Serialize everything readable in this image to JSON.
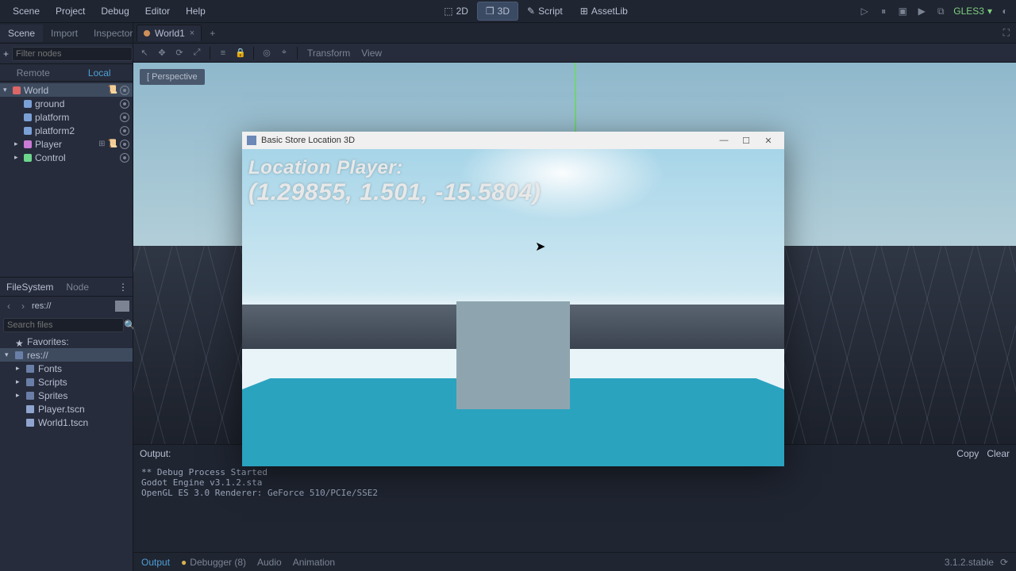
{
  "menu": {
    "items": [
      "Scene",
      "Project",
      "Debug",
      "Editor",
      "Help"
    ]
  },
  "center_modes": {
    "d2": "2D",
    "d3": "3D",
    "script": "Script",
    "assetlib": "AssetLib",
    "active": "d3"
  },
  "top_right": {
    "renderer": "GLES3"
  },
  "scene_panel": {
    "tabs": [
      "Scene",
      "Import",
      "Inspector"
    ],
    "active_tab": 0,
    "filter_placeholder": "Filter nodes",
    "remote": "Remote",
    "local": "Local",
    "nodes": [
      {
        "name": "World",
        "kind": "world",
        "depth": 0,
        "expanded": true,
        "selected": true,
        "script": true,
        "vis": true
      },
      {
        "name": "ground",
        "kind": "mesh",
        "depth": 1,
        "vis": true
      },
      {
        "name": "platform",
        "kind": "mesh",
        "depth": 1,
        "vis": true
      },
      {
        "name": "platform2",
        "kind": "mesh",
        "depth": 1,
        "vis": true
      },
      {
        "name": "Player",
        "kind": "player",
        "depth": 1,
        "expanded": false,
        "script": true,
        "link": true,
        "vis": true
      },
      {
        "name": "Control",
        "kind": "ctrl",
        "depth": 1,
        "expanded": false,
        "vis": true
      }
    ]
  },
  "filesystem": {
    "tabs": [
      "FileSystem",
      "Node"
    ],
    "active_tab": 0,
    "path": "res://",
    "search_placeholder": "Search files",
    "items": [
      {
        "label": "Favorites:",
        "icon": "star",
        "caret": ""
      },
      {
        "label": "res://",
        "icon": "folder",
        "caret": "▾",
        "selected": true
      },
      {
        "label": "Fonts",
        "icon": "folder",
        "caret": "▸",
        "indent": 1
      },
      {
        "label": "Scripts",
        "icon": "folder",
        "caret": "▸",
        "indent": 1
      },
      {
        "label": "Sprites",
        "icon": "folder",
        "caret": "▸",
        "indent": 1
      },
      {
        "label": "Player.tscn",
        "icon": "scene",
        "caret": "",
        "indent": 1
      },
      {
        "label": "World1.tscn",
        "icon": "scene",
        "caret": "",
        "indent": 1
      }
    ]
  },
  "open_scene": {
    "name": "World1",
    "close": "×",
    "add": "+"
  },
  "viewport": {
    "perspective_label": "Perspective",
    "tool_text": {
      "transform": "Transform",
      "view": "View"
    }
  },
  "output": {
    "title": "Output:",
    "copy": "Copy",
    "clear": "Clear",
    "lines": [
      "** Debug Process Started",
      "Godot Engine v3.1.2.sta",
      "OpenGL ES 3.0 Renderer: GeForce 510/PCIe/SSE2"
    ],
    "tabs": {
      "output": "Output",
      "debugger": "Debugger (8)",
      "audio": "Audio",
      "animation": "Animation"
    },
    "version": "3.1.2.stable"
  },
  "game_window": {
    "title": "Basic Store Location 3D",
    "label": "Location Player:",
    "coords": "(1.29855, 1.501, -15.5804)"
  }
}
